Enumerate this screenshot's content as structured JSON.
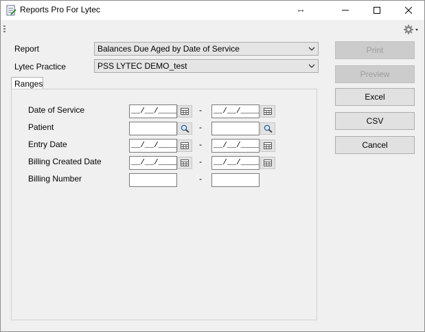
{
  "window": {
    "title": "Reports Pro For Lytec",
    "minimize_icon": "minimize-icon",
    "maximize_icon": "maximize-icon",
    "close_icon": "close-icon"
  },
  "toolbar": {
    "settings_icon": "gear-icon"
  },
  "form": {
    "report_label": "Report",
    "report_value": "Balances Due Aged by Date of Service",
    "practice_label": "Lytec Practice",
    "practice_value": "PSS LYTEC DEMO_test"
  },
  "tabs": [
    {
      "label": "Ranges"
    }
  ],
  "ranges": {
    "dash": "-",
    "rows": [
      {
        "label": "Date of Service",
        "from": "__/__/____",
        "to": "__/__/____",
        "picker": "calendar-icon"
      },
      {
        "label": "Patient",
        "from": "",
        "to": "",
        "picker": "search-icon"
      },
      {
        "label": "Entry Date",
        "from": "__/__/____",
        "to": "__/__/____",
        "picker": "calendar-icon"
      },
      {
        "label": "Billing Created Date",
        "from": "__/__/____",
        "to": "__/__/____",
        "picker": "calendar-icon"
      },
      {
        "label": "Billing Number",
        "from": "",
        "to": "",
        "picker": ""
      }
    ]
  },
  "buttons": {
    "print": "Print",
    "preview": "Preview",
    "excel": "Excel",
    "csv": "CSV",
    "cancel": "Cancel"
  },
  "colors": {
    "window_bg": "#f0f0f0",
    "disabled_button": "#cccccc"
  }
}
